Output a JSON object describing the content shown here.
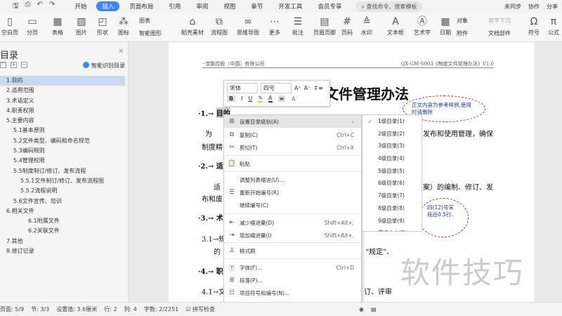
{
  "menu_tabs": [
    "开始",
    "插入",
    "页面布局",
    "引用",
    "审阅",
    "视图",
    "章节",
    "开发工具",
    "会员专享"
  ],
  "active_tab": "插入",
  "search_placeholder": "查找命令、搜索模板",
  "top_right": [
    "未同步",
    "协作",
    "分享"
  ],
  "ribbon": [
    "空白页",
    "分页",
    "表格",
    "图片",
    "形状",
    "图标",
    "稻壳素材",
    "流程图",
    "思维导图",
    "更多",
    "批注",
    "页眉页脚",
    "页码",
    "水印",
    "文本框",
    "艺术字",
    "日期",
    "符号",
    "公式"
  ],
  "ribbon_small": [
    "图表",
    "智能图形",
    "对象",
    "附件",
    "首字下沉",
    "文档部件"
  ],
  "panel": {
    "title": "目录",
    "smart": "智能识别目录",
    "items": [
      "1.目的",
      "2.适用范围",
      "3.术语定义",
      "4.职责权限",
      "5.主要内容",
      "5.1基本原则",
      "5.2文件类型、编码和命名规范",
      "5.3编码规则",
      "5.4管理权限",
      "5.5制度制订/修订、发布流程",
      "5.5.1文件制订/修订、发布流程图",
      "5.5.2流程说明",
      "5.6文件宣传、培训",
      "6.相关文件",
      "6.1附属文件",
      "6.2关联文件",
      "7.其他",
      "8.修订记录"
    ]
  },
  "doc": {
    "header_left": "··宝能控股（中国）有限公司",
    "header_right": "QX-GM-S003《制度文件管理办法》V1.0",
    "title": "文件管理办法",
    "h1": "·1.→ 目的",
    "p1a": "为",
    "p1b": "发布和使用管理，确保",
    "p1c": "制度精",
    "h2": "·2.→ 适",
    "p2a": "适",
    "p2b": "案）的编制、修订、发",
    "p2c": "布和废",
    "h3": "·3.→ 术",
    "p3a": "3.1→规",
    "p3b": "的",
    "p3c": "“规定”、",
    "h4": "·4.→ 职",
    "p4a": "4.1→文",
    "p4b": "订、评审",
    "cloud1": "正文内容为参考样例,使用时请删除",
    "cloud2": "四(12)号宋 段后0.5行."
  },
  "mini": {
    "font": "宋体",
    "size": "四号"
  },
  "context_menu": [
    {
      "icon": "toc-level-icon",
      "label": "设置目录级别(A)",
      "shortcut": "›"
    },
    {
      "icon": "copy-icon",
      "label": "复制(C)",
      "shortcut": "Ctrl+C"
    },
    {
      "icon": "cut-icon",
      "label": "剪切(T)",
      "shortcut": "Ctrl+X"
    },
    {
      "icon": "paste-icon",
      "label": "粘贴",
      "shortcut": ""
    },
    {
      "icon": "",
      "label": "调整列表缩进(U)...",
      "shortcut": ""
    },
    {
      "icon": "restart-numbering-icon",
      "label": "重新开始编号(R)",
      "shortcut": ""
    },
    {
      "icon": "",
      "label": "继续编号(C)",
      "shortcut": ""
    },
    {
      "icon": "decrease-indent-icon",
      "label": "减少缩进量(D)",
      "shortcut": "Shift+Alt+,"
    },
    {
      "icon": "increase-indent-icon",
      "label": "增加缩进量(I)",
      "shortcut": "Shift+Alt+."
    },
    {
      "icon": "format-painter-icon",
      "label": "格式刷",
      "shortcut": ""
    },
    {
      "icon": "font-icon",
      "label": "字体(F)...",
      "shortcut": "Ctrl+D"
    },
    {
      "icon": "paragraph-icon",
      "label": "段落(P)...",
      "shortcut": ""
    },
    {
      "icon": "bullets-icon",
      "label": "项目符号和编号(N)...",
      "shortcut": ""
    }
  ],
  "submenu": [
    "1级目录(1)",
    "2级目录(2)",
    "3级目录(3)",
    "4级目录(4)",
    "5级目录(5)",
    "6级目录(6)",
    "7级目录(7)",
    "8级目录(8)",
    "9级目录(9)",
    "普通文本(P)"
  ],
  "status": {
    "page": "页面: 5/9",
    "section": "节: 3/3",
    "setting": "设置值: 3.6厘米",
    "row": "行: 2",
    "col": "列: 4",
    "words": "字数: 2/2251",
    "spell": "拼写检查"
  },
  "watermark": "软件技巧"
}
